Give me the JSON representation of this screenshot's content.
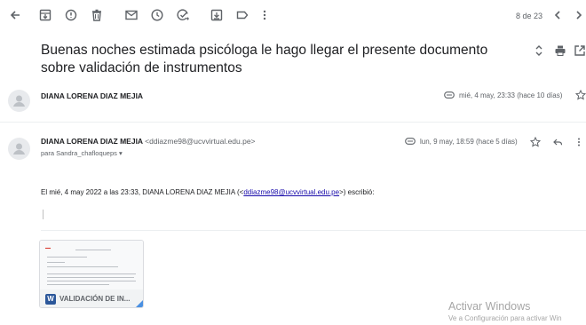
{
  "toolbar": {
    "icons": [
      "back-arrow-icon",
      "archive-icon",
      "report-spam-icon",
      "delete-icon",
      "mark-unread-icon",
      "snooze-icon",
      "add-to-tasks-icon",
      "move-to-icon",
      "label-icon",
      "more-vert-icon"
    ],
    "counter": "8 de 23"
  },
  "subject": "Buenas noches estimada psicóloga le hago llegar el presente documento sobre validación de instrumentos",
  "messages": [
    {
      "sender": "DIANA LORENA DIAZ MEJIA",
      "date": "mié, 4 may, 23:33 (hace 10 días)"
    },
    {
      "sender": "DIANA LORENA DIAZ MEJIA",
      "sender_email": "<ddiazme98@ucvvirtual.edu.pe>",
      "to_line": "para Sandra_chafloqueps ▾",
      "date": "lun, 9 may, 18:59 (hace 5 días)",
      "quote_prefix": "El mié, 4 may 2022 a las 23:33, DIANA LORENA DIAZ MEJIA (<",
      "quote_link": "ddiazme98@ucvvirtual.edu.pe",
      "quote_suffix": ">) escribió:",
      "attachment": {
        "icon_letter": "W",
        "name": "VALIDACIÓN DE IN..."
      }
    }
  ],
  "watermark": {
    "title": "Activar Windows",
    "subtitle": "Ve a Configuración para activar Win"
  },
  "colors": {
    "icon_gray": "#5f6368",
    "link": "#1a0dab",
    "word_blue": "#2b579a"
  }
}
